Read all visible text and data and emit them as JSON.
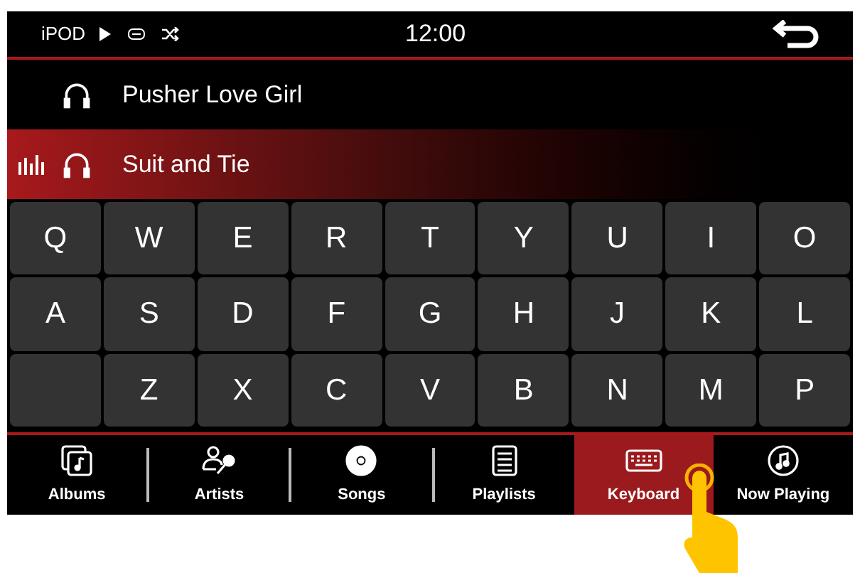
{
  "status_bar": {
    "source": "iPOD",
    "playing": true,
    "time": "12:00"
  },
  "songs": [
    {
      "title": "Pusher Love Girl",
      "selected": false
    },
    {
      "title": "Suit and Tie",
      "selected": true
    }
  ],
  "keyboard": {
    "rows": [
      [
        {
          "kind": "letter",
          "label": "Q"
        },
        {
          "kind": "letter",
          "label": "W"
        },
        {
          "kind": "letter",
          "label": "E"
        },
        {
          "kind": "letter",
          "label": "R"
        },
        {
          "kind": "letter",
          "label": "T"
        },
        {
          "kind": "letter",
          "label": "Y"
        },
        {
          "kind": "letter",
          "label": "U"
        },
        {
          "kind": "letter",
          "label": "I"
        },
        {
          "kind": "letter",
          "label": "O"
        }
      ],
      [
        {
          "kind": "letter",
          "label": "A"
        },
        {
          "kind": "letter",
          "label": "S"
        },
        {
          "kind": "letter",
          "label": "D"
        },
        {
          "kind": "letter",
          "label": "F"
        },
        {
          "kind": "letter",
          "label": "G"
        },
        {
          "kind": "letter",
          "label": "H"
        },
        {
          "kind": "letter",
          "label": "J"
        },
        {
          "kind": "letter",
          "label": "K"
        },
        {
          "kind": "letter",
          "label": "L"
        }
      ],
      [
        {
          "kind": "blank"
        },
        {
          "kind": "letter",
          "label": "Z"
        },
        {
          "kind": "letter",
          "label": "X"
        },
        {
          "kind": "letter",
          "label": "C"
        },
        {
          "kind": "letter",
          "label": "V"
        },
        {
          "kind": "letter",
          "label": "B"
        },
        {
          "kind": "letter",
          "label": "N"
        },
        {
          "kind": "letter",
          "label": "M"
        },
        {
          "kind": "letter",
          "label": "P"
        }
      ]
    ]
  },
  "tabs": [
    {
      "kind": "albums",
      "label": "Albums",
      "selected": false
    },
    {
      "kind": "artists",
      "label": "Artists",
      "selected": false
    },
    {
      "kind": "songs",
      "label": "Songs",
      "selected": false
    },
    {
      "kind": "playlists",
      "label": "Playlists",
      "selected": false
    },
    {
      "kind": "keyboard",
      "label": "Keyboard",
      "selected": true
    },
    {
      "kind": "now_playing",
      "label": "Now Playing",
      "selected": false
    }
  ]
}
